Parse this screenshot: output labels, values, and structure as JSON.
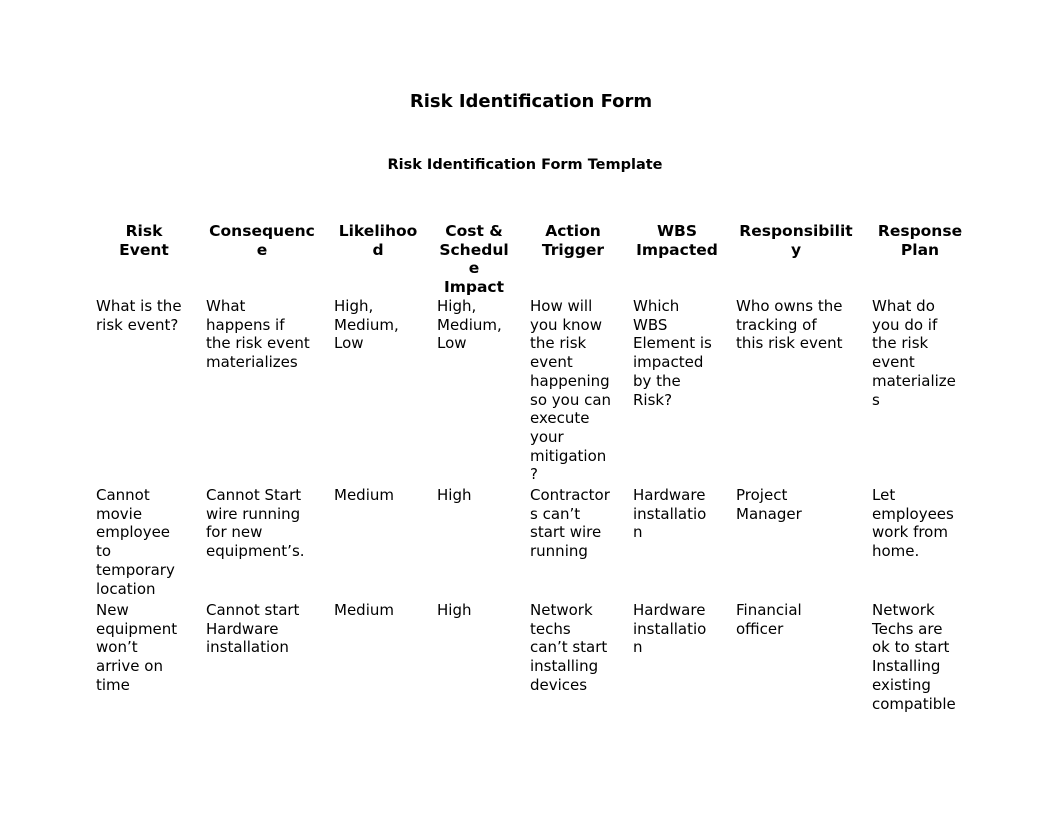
{
  "document": {
    "title": "Risk Identification Form",
    "subtitle": "Risk Identification Form Template"
  },
  "table": {
    "headers": [
      "Risk\nEvent",
      "Consequenc\ne",
      "Likelihoo\nd",
      "Cost &\nSchedul\ne\nImpact",
      "Action\nTrigger",
      "WBS\nImpacted",
      "Responsibilit\ny",
      "Response\nPlan"
    ],
    "rows": [
      [
        "What is the\nrisk event?",
        "What\nhappens if\nthe risk event\nmaterializes",
        "High,\nMedium,\nLow",
        "High,\nMedium,\nLow",
        "How will\nyou know\nthe risk\nevent\nhappening\nso you can\nexecute\nyour\nmitigation\n?",
        "Which\nWBS\nElement is\nimpacted\nby the\nRisk?",
        "Who owns the\ntracking of\nthis risk event",
        "What do\nyou do if\nthe risk\nevent\nmaterialize\ns"
      ],
      [
        "Cannot\nmovie\nemployee\nto\ntemporary\nlocation",
        "Cannot Start\nwire running\nfor new\nequipment’s.",
        "Medium",
        "High",
        "Contractor\ns can’t\nstart wire\nrunning",
        "Hardware\ninstallatio\nn",
        "Project\nManager",
        "Let\nemployees\nwork from\nhome."
      ],
      [
        "New\nequipment\nwon’t\narrive on\ntime",
        "Cannot start\nHardware\ninstallation",
        "Medium",
        "High",
        "Network\ntechs\ncan’t start\ninstalling\ndevices",
        "Hardware\ninstallatio\nn",
        "Financial\nofficer",
        "Network\nTechs are\nok to start\nInstalling\nexisting\ncompatible"
      ]
    ]
  }
}
